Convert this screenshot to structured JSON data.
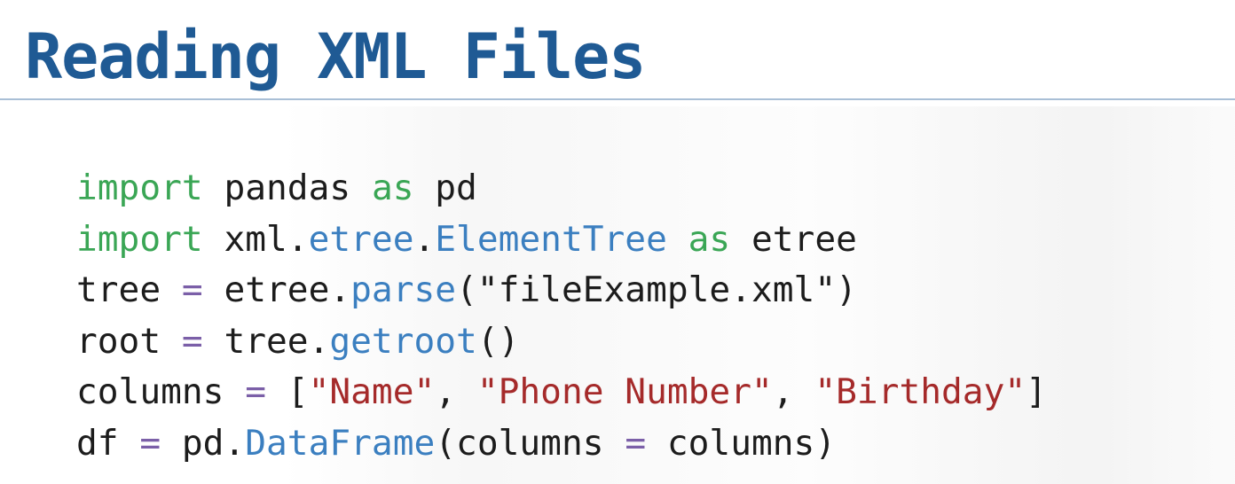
{
  "slide": {
    "title": "Reading XML Files"
  },
  "colors": {
    "title": "#1f5a94",
    "rule": "#a9bfd6",
    "keyword": "#3aa655",
    "function": "#3b7fc0",
    "string": "#a52a2a",
    "operator": "#7b5fa8",
    "text": "#1c1c1c"
  },
  "code": {
    "lines": [
      {
        "tokens": [
          {
            "t": "kw",
            "text": "import"
          },
          {
            "t": "txt",
            "text": " pandas "
          },
          {
            "t": "kw",
            "text": "as"
          },
          {
            "t": "txt",
            "text": " pd"
          }
        ]
      },
      {
        "tokens": [
          {
            "t": "kw",
            "text": "import"
          },
          {
            "t": "txt",
            "text": " xml."
          },
          {
            "t": "fn",
            "text": "etree"
          },
          {
            "t": "txt",
            "text": "."
          },
          {
            "t": "fn",
            "text": "ElementTree"
          },
          {
            "t": "txt",
            "text": " "
          },
          {
            "t": "kw",
            "text": "as"
          },
          {
            "t": "txt",
            "text": " etree"
          }
        ]
      },
      {
        "tokens": [
          {
            "t": "txt",
            "text": "tree "
          },
          {
            "t": "op",
            "text": "="
          },
          {
            "t": "txt",
            "text": " etree."
          },
          {
            "t": "fn",
            "text": "parse"
          },
          {
            "t": "txt",
            "text": "("
          },
          {
            "t": "txt",
            "text": "\"fileExample.xml\""
          },
          {
            "t": "txt",
            "text": ")"
          }
        ]
      },
      {
        "tokens": [
          {
            "t": "txt",
            "text": "root "
          },
          {
            "t": "op",
            "text": "="
          },
          {
            "t": "txt",
            "text": " tree."
          },
          {
            "t": "fn",
            "text": "getroot"
          },
          {
            "t": "txt",
            "text": "()"
          }
        ]
      },
      {
        "tokens": [
          {
            "t": "txt",
            "text": "columns "
          },
          {
            "t": "op",
            "text": "="
          },
          {
            "t": "txt",
            "text": " ["
          },
          {
            "t": "str",
            "text": "\"Name\""
          },
          {
            "t": "txt",
            "text": ", "
          },
          {
            "t": "str",
            "text": "\"Phone Number\""
          },
          {
            "t": "txt",
            "text": ", "
          },
          {
            "t": "str",
            "text": "\"Birthday\""
          },
          {
            "t": "txt",
            "text": "]"
          }
        ]
      },
      {
        "tokens": [
          {
            "t": "txt",
            "text": "df "
          },
          {
            "t": "op",
            "text": "="
          },
          {
            "t": "txt",
            "text": " pd."
          },
          {
            "t": "fn",
            "text": "DataFrame"
          },
          {
            "t": "txt",
            "text": "(columns "
          },
          {
            "t": "op",
            "text": "="
          },
          {
            "t": "txt",
            "text": " columns)"
          }
        ]
      }
    ]
  }
}
